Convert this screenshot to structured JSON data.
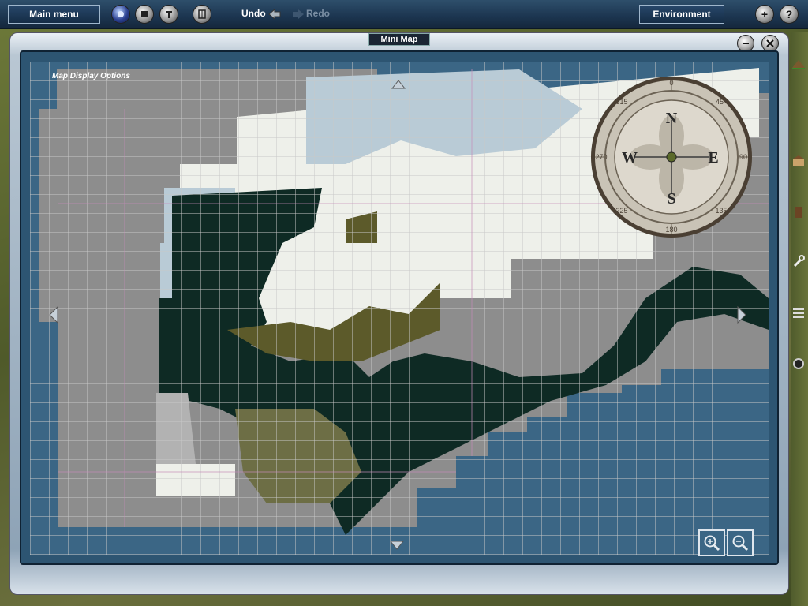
{
  "toolbar": {
    "main_menu_label": "Main menu",
    "undo_label": "Undo",
    "redo_label": "Redo",
    "environment_label": "Environment",
    "icons": [
      "lamp-icon",
      "stop-icon",
      "tool-icon",
      "layers-icon",
      "plus-icon",
      "help-icon"
    ]
  },
  "window": {
    "title": "Mini Map",
    "map_display_options_label": "Map Display Options"
  },
  "compass": {
    "north": "N",
    "south": "S",
    "east": "E",
    "west": "W",
    "deg0": "0",
    "deg45": "45",
    "deg90": "90",
    "deg135": "135",
    "deg180": "180",
    "deg225": "225",
    "deg270": "270",
    "deg315": "315"
  },
  "colors": {
    "sea": "#3b6685",
    "grid_gray": "#8d8d8d",
    "dark_land": "#0e2a24",
    "snow": "#eef0ea",
    "shallow": "#b9cbd6",
    "olive": "#5c5a2a"
  }
}
